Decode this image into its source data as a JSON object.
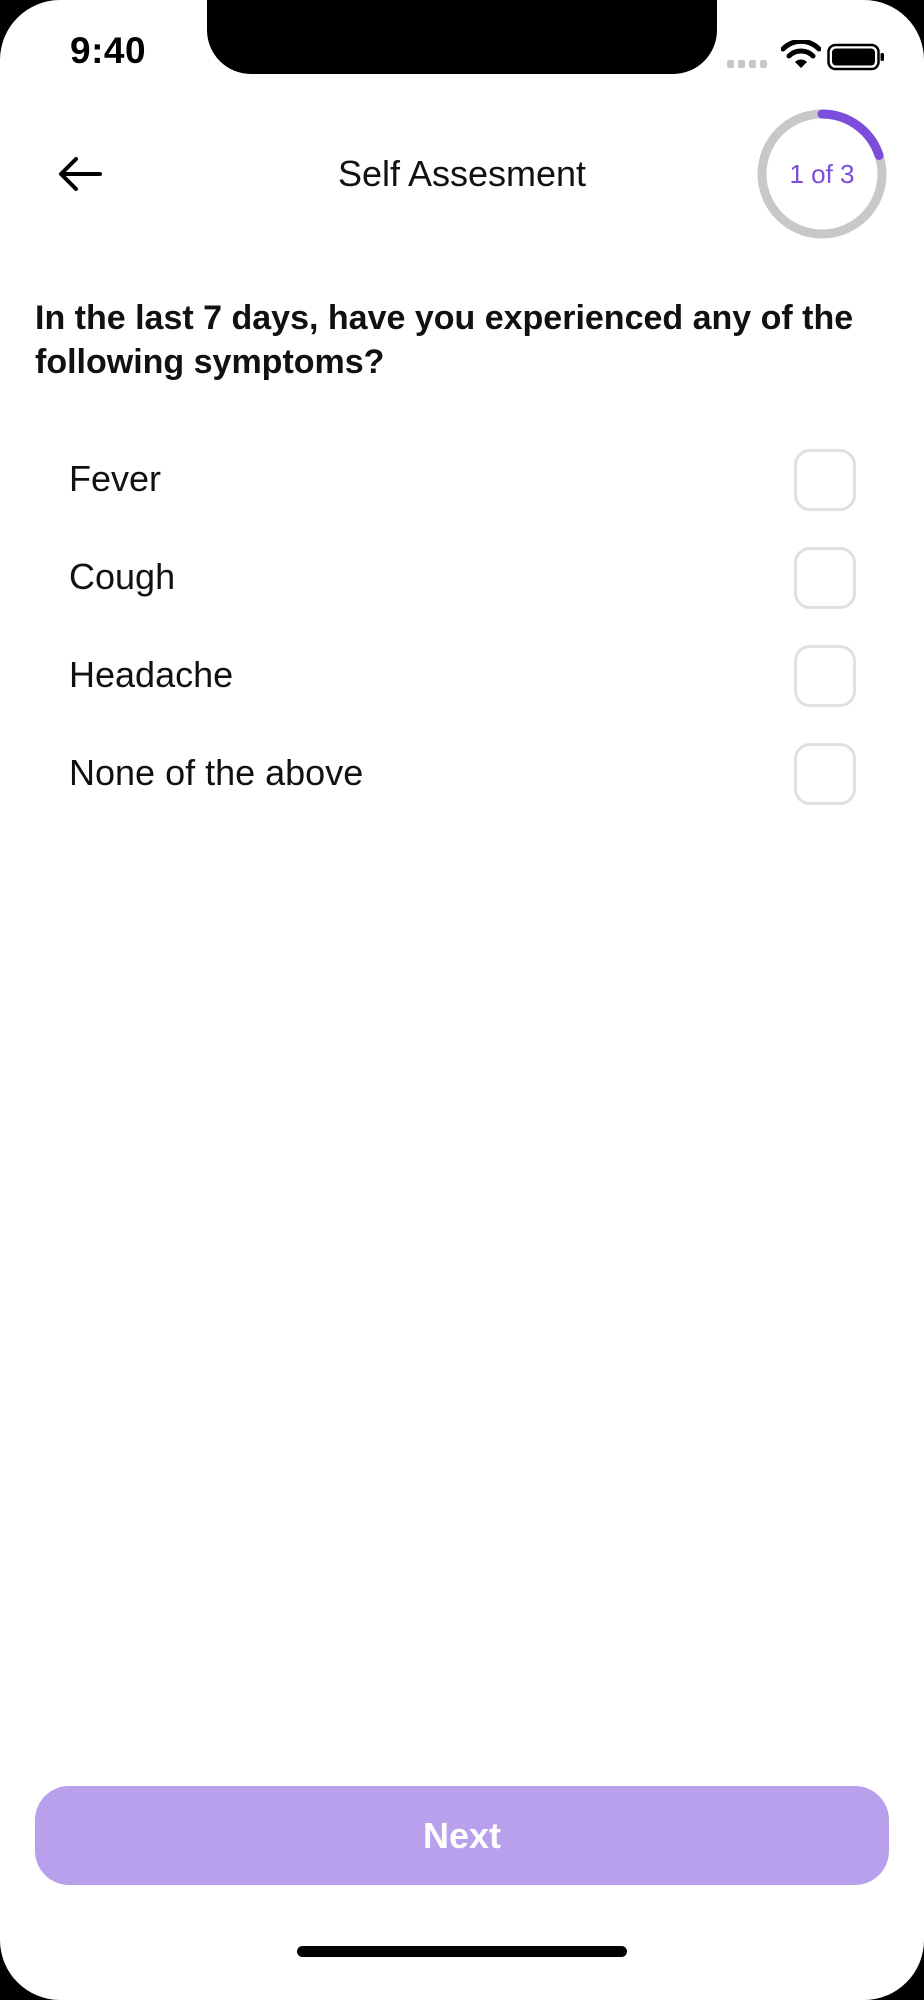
{
  "status_bar": {
    "time": "9:40"
  },
  "header": {
    "title": "Self Assesment",
    "back_icon": "arrow-left-icon",
    "progress": {
      "label": "1 of 3",
      "fraction": 0.2,
      "accent_color": "#7c4ddb",
      "track_color": "#c8c8c8"
    }
  },
  "question": {
    "text": "In the last 7 days, have you experienced any of the following symptoms?"
  },
  "options": [
    {
      "label": "Fever",
      "checked": false
    },
    {
      "label": "Cough",
      "checked": false
    },
    {
      "label": "Headache",
      "checked": false
    },
    {
      "label": "None of the above",
      "checked": false
    }
  ],
  "footer": {
    "next_label": "Next",
    "button_color": "#b8a0ec"
  }
}
